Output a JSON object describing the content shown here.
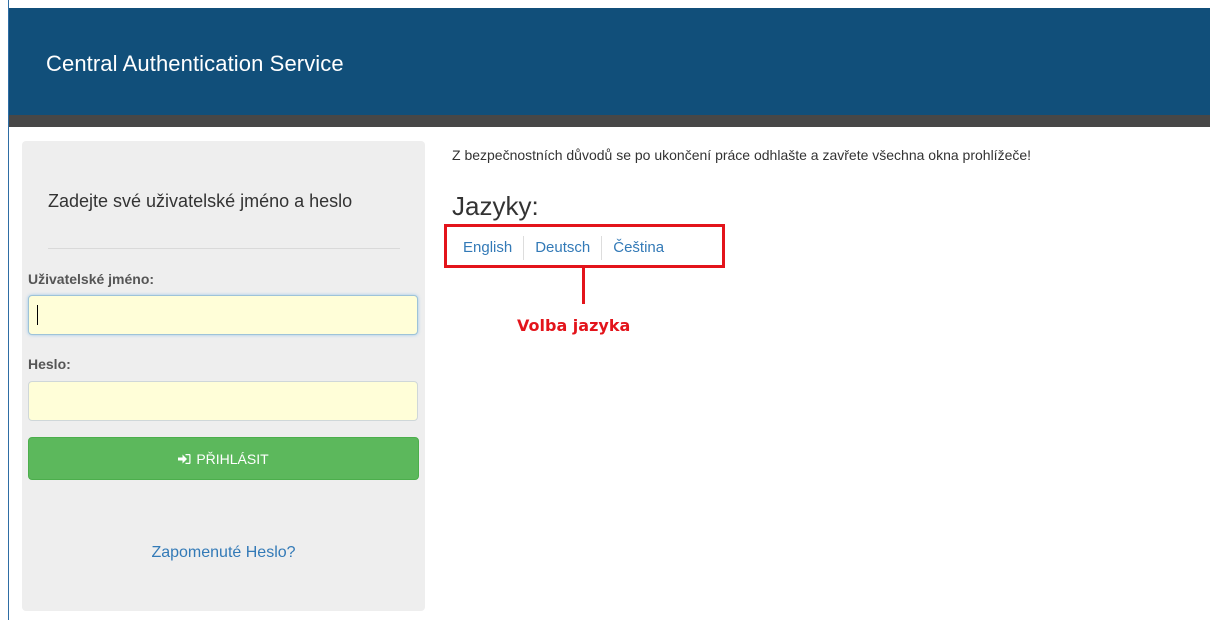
{
  "header": {
    "title": "Central Authentication Service"
  },
  "login": {
    "heading": "Zadejte své uživatelské jméno a heslo",
    "username_label": "Uživatelské jméno:",
    "username_value": "",
    "password_label": "Heslo:",
    "password_value": "",
    "submit_label": "PŘIHLÁSIT",
    "submit_icon": "sign-in-icon",
    "forgot_password": "Zapomenuté Heslo?"
  },
  "info": {
    "security_note": "Z bezpečnostních důvodů se po ukončení práce odhlašte a zavřete všechna okna prohlížeče!"
  },
  "languages": {
    "heading": "Jazyky:",
    "items": [
      "English",
      "Deutsch",
      "Čeština"
    ]
  },
  "annotation": {
    "label": "Volba jazyka",
    "color": "#e3141b"
  },
  "colors": {
    "header_bg": "#114f7a",
    "header_bar": "#474747",
    "panel_bg": "#eeeeee",
    "input_bg": "#fffed8",
    "button_bg": "#5cb85c",
    "link": "#337ab7"
  }
}
